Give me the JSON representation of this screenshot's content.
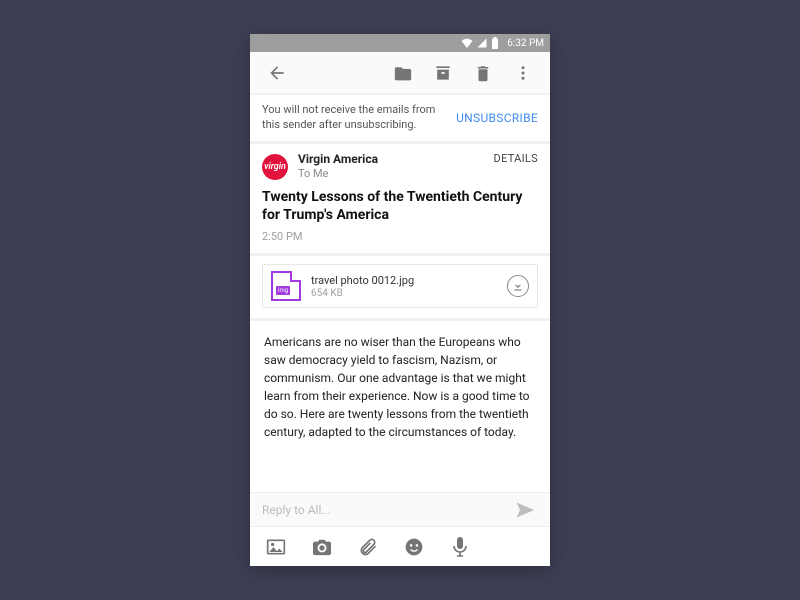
{
  "statusbar": {
    "time": "6:32 PM"
  },
  "unsubscribe": {
    "text": "You will not receive the emails from this sender after unsubscribing.",
    "action": "UNSUBSCRIBE"
  },
  "sender": {
    "avatar_label": "virgin",
    "name": "Virgin America",
    "to": "To Me",
    "details": "DETAILS"
  },
  "subject": {
    "text": "Twenty Lessons of the Twentieth Century for Trump's America",
    "time": "2:50 PM"
  },
  "attachment": {
    "name": "travel photo 0012.jpg",
    "size": "654 KB",
    "tag": "img"
  },
  "body": "Americans are no wiser than the Europeans who saw democracy yield to fascism, Nazism, or communism. Our one advantage is that we might learn from their experience. Now is a good time to do so. Here are twenty lessons from the twentieth century, adapted to the circumstances of today.",
  "reply": {
    "placeholder": "Reply to All..."
  }
}
